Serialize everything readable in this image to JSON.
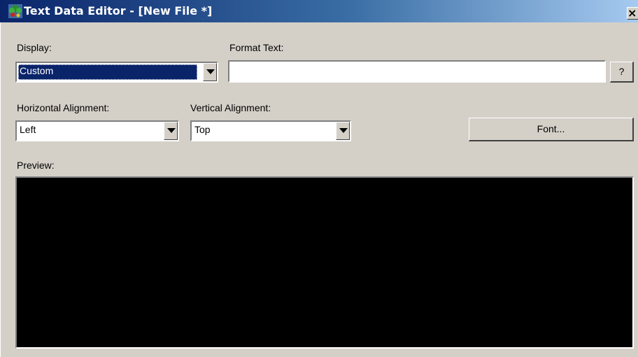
{
  "window": {
    "title": "Text Data Editor - [New File *]",
    "close_glyph": "×"
  },
  "display": {
    "label": "Display:",
    "value": "Custom"
  },
  "format_text": {
    "label": "Format Text:",
    "value": "",
    "help_label": "?"
  },
  "horizontal_alignment": {
    "label": "Horizontal Alignment:",
    "value": "Left"
  },
  "vertical_alignment": {
    "label": "Vertical Alignment:",
    "value": "Top"
  },
  "font_button": {
    "label": "Font..."
  },
  "preview": {
    "label": "Preview:",
    "background": "#000000"
  },
  "colors": {
    "title_gradient_start": "#0a246a",
    "title_gradient_end": "#a6caf0",
    "dialog_background": "#d4d0c8",
    "selection": "#0a246a"
  },
  "icons": {
    "app": "app-tree-icon",
    "dropdown": "chevron-down-icon"
  }
}
